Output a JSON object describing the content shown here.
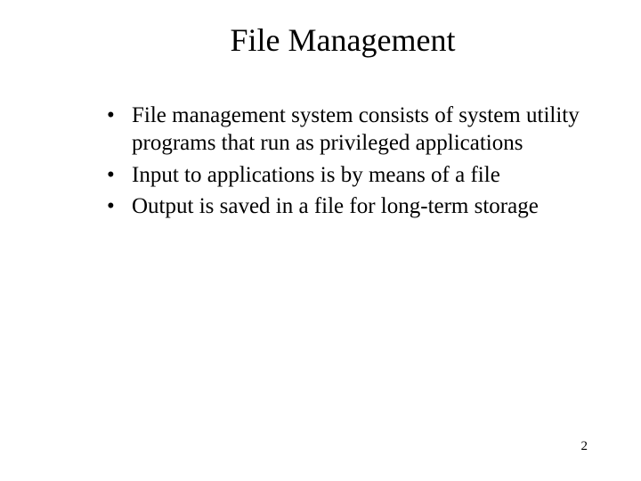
{
  "slide": {
    "title": "File Management",
    "bullets": [
      "File management system consists of system utility programs that run as privileged applications",
      "Input to applications is by means of a file",
      "Output is saved in a file for long-term storage"
    ],
    "page_number": "2"
  }
}
